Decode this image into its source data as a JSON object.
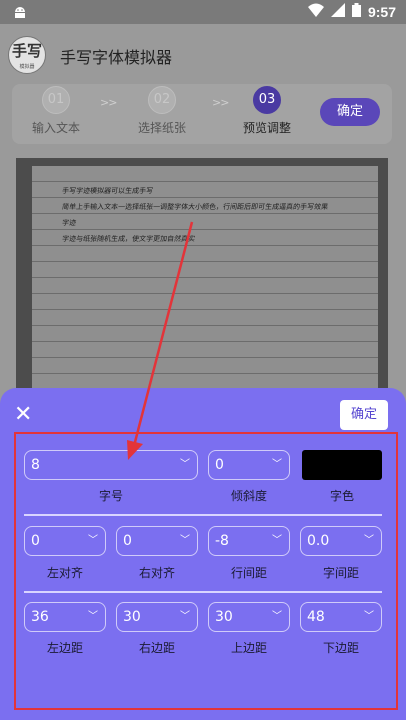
{
  "statusbar": {
    "time": "9:57"
  },
  "app": {
    "title": "手写字体模拟器",
    "logo_text": "手写",
    "logo_sub": "模拟器"
  },
  "steps": [
    {
      "num": "01",
      "label": "输入文本",
      "active": false
    },
    {
      "num": "02",
      "label": "选择纸张",
      "active": false
    },
    {
      "num": "03",
      "label": "预览调整",
      "active": true
    }
  ],
  "stepper": {
    "chevrons": ">>",
    "confirm_label": "确定"
  },
  "preview": {
    "lines": [
      "手写字迹模拟器可以生成手写",
      "简单上手输入文本一选择纸张一调整字体大小颜色，行间距后即可生成逼真的手写效果",
      "字迹",
      "字迹与纸张随机生成，使文字更加自然真实"
    ]
  },
  "panel": {
    "confirm_label": "确定",
    "close_icon": "close-icon",
    "row1": [
      {
        "value": "8",
        "label": "字号"
      },
      {
        "value": "0",
        "label": "倾斜度"
      }
    ],
    "color_label": "字色",
    "color_value": "#000000",
    "row2": [
      {
        "value": "0",
        "label": "左对齐"
      },
      {
        "value": "0",
        "label": "右对齐"
      },
      {
        "value": "-8",
        "label": "行间距"
      },
      {
        "value": "0.0",
        "label": "字间距"
      }
    ],
    "row3": [
      {
        "value": "36",
        "label": "左边距"
      },
      {
        "value": "30",
        "label": "右边距"
      },
      {
        "value": "30",
        "label": "上边距"
      },
      {
        "value": "48",
        "label": "下边距"
      }
    ]
  },
  "colors": {
    "accent": "#7b6ff0",
    "highlight": "#e3343a",
    "step_active": "#4a3aa2"
  }
}
